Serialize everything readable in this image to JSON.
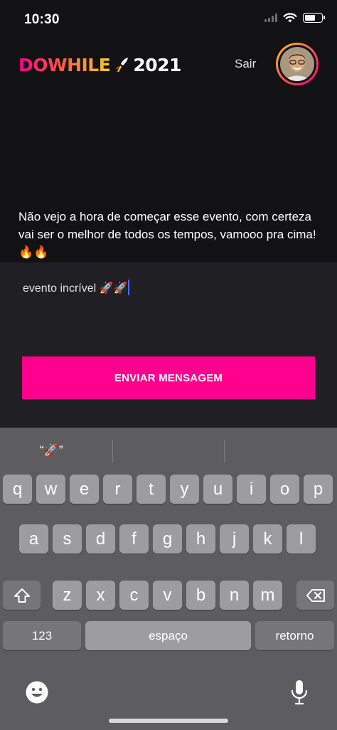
{
  "status_bar": {
    "time": "10:30"
  },
  "header": {
    "logo_brand": "DOWHILE",
    "logo_year": "2021",
    "signout_label": "Sair",
    "icons": [
      "rocket-icon",
      "avatar"
    ]
  },
  "message": {
    "text": "Não vejo a hora de começar esse evento, com certeza vai ser o melhor de todos os tempos, vamooo pra cima! 🔥🔥"
  },
  "form": {
    "input_value": "evento incrível 🚀🚀",
    "send_label": "ENVIAR MENSAGEM"
  },
  "keyboard": {
    "suggestion": "“🚀”",
    "row1": [
      "q",
      "w",
      "e",
      "r",
      "t",
      "y",
      "u",
      "i",
      "o",
      "p"
    ],
    "row2": [
      "a",
      "s",
      "d",
      "f",
      "g",
      "h",
      "j",
      "k",
      "l"
    ],
    "row3": [
      "z",
      "x",
      "c",
      "v",
      "b",
      "n",
      "m"
    ],
    "numbers_label": "123",
    "space_label": "espaço",
    "return_label": "retorno",
    "icons": [
      "shift-icon",
      "backspace-icon",
      "emoji-icon",
      "microphone-icon"
    ]
  },
  "colors": {
    "background": "#121214",
    "form_background": "#202024",
    "accent_pink": "#ff008e",
    "accent_yellow": "#ffcd1e"
  }
}
